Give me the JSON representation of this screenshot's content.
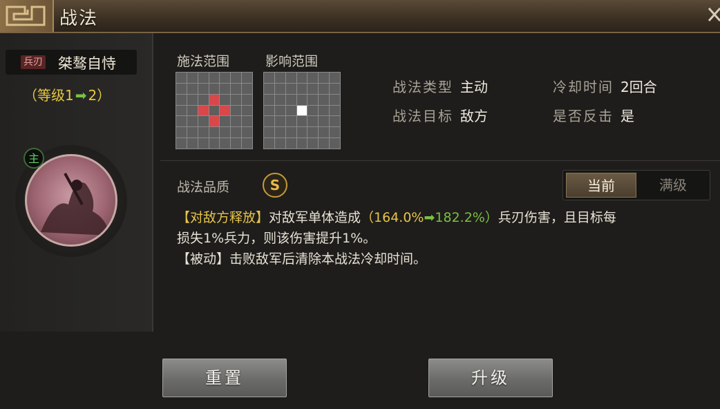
{
  "header": {
    "title": "战法"
  },
  "skill": {
    "weapon_tag": "兵刃",
    "name": "桀骜自恃",
    "level_prefix": "（等级1",
    "level_suffix": "2）",
    "commander_badge": "主"
  },
  "ranges": {
    "cast_label": "施法范围",
    "effect_label": "影响范围"
  },
  "attributes": {
    "type_key": "战法类型",
    "type_value": "主动",
    "cooldown_key": "冷却时间",
    "cooldown_value": "2回合",
    "target_key": "战法目标",
    "target_value": "敌方",
    "counter_key": "是否反击",
    "counter_value": "是"
  },
  "quality": {
    "label": "战法品质",
    "grade": "S"
  },
  "toggle": {
    "current": "当前",
    "max": "满级"
  },
  "description": {
    "line1_tag": "【对敌方释放】",
    "line1_text": "对敌军单体造成",
    "dmg_open": "（164.0%",
    "dmg_new": "182.2%）",
    "line1_tail": "兵刃伤害，且目标每",
    "line2": "损失1%兵力，则该伤害提升1%。",
    "line3": "【被动】击败敌军后清除本战法冷却时间。"
  },
  "buttons": {
    "reset": "重置",
    "upgrade": "升级"
  },
  "colors": {
    "accent_gold": "#e6c44a",
    "upgrade_green": "#7ac142",
    "range_red": "#d9474a"
  }
}
